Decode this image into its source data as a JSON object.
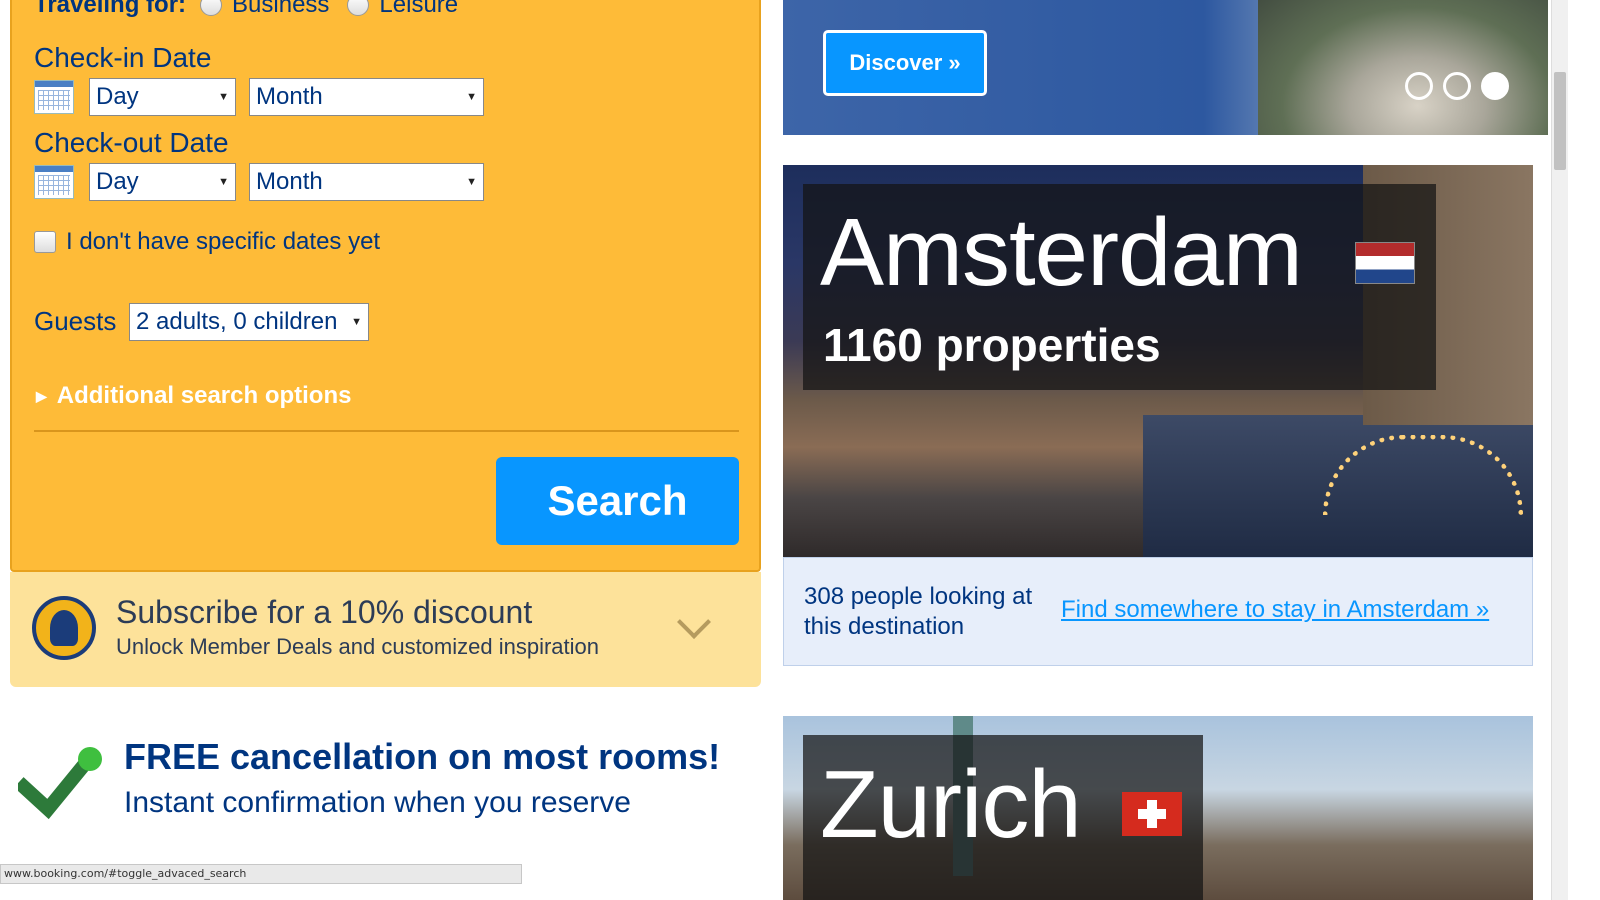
{
  "search": {
    "traveling_for_label": "Traveling for:",
    "traveling_options": [
      "Business",
      "Leisure"
    ],
    "checkin_label": "Check-in Date",
    "checkout_label": "Check-out Date",
    "day_placeholder": "Day",
    "month_placeholder": "Month",
    "no_dates_label": "I don't have specific dates yet",
    "guests_label": "Guests",
    "guests_value": "2 adults, 0 children",
    "additional_options": "Additional search options",
    "search_button": "Search"
  },
  "subscribe": {
    "title": "Subscribe for a 10% discount",
    "text": "Unlock Member Deals and customized inspiration"
  },
  "promo": {
    "free_cancellation": "FREE cancellation on most rooms!",
    "instant_confirmation": "Instant confirmation when you reserve"
  },
  "status_bar": "www.booking.com/#toggle_advaced_search",
  "banner": {
    "discover_button": "Discover »"
  },
  "destinations": [
    {
      "city": "Amsterdam",
      "properties": "1160 properties",
      "people_looking": "308 people looking at this destination",
      "link": "Find somewhere to stay in Amsterdam »",
      "flag": "netherlands-flag"
    },
    {
      "city": "Zurich",
      "flag": "switzerland-flag"
    }
  ],
  "colors": {
    "panel": "#febb38",
    "primary_blue": "#003580",
    "button_blue": "#0896ff"
  }
}
